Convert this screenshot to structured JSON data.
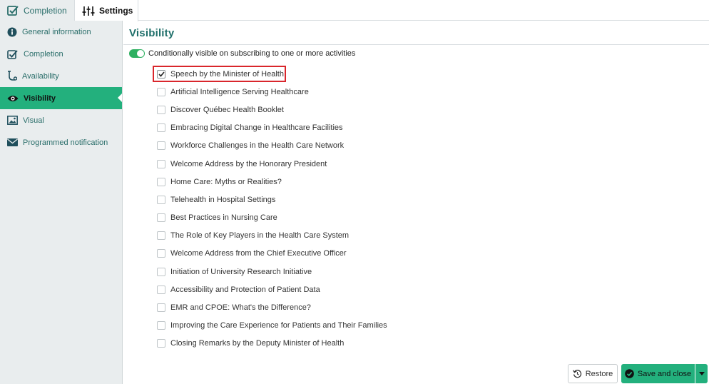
{
  "tabs": {
    "completion": "Completion",
    "settings": "Settings"
  },
  "sidebar": {
    "items": [
      {
        "label": "General information",
        "icon": "info-icon"
      },
      {
        "label": "Completion",
        "icon": "checkbox-check-icon"
      },
      {
        "label": "Availability",
        "icon": "availability-icon"
      },
      {
        "label": "Visibility",
        "icon": "eye-icon",
        "active": true
      },
      {
        "label": "Visual",
        "icon": "image-icon"
      },
      {
        "label": "Programmed notification",
        "icon": "envelope-icon"
      }
    ]
  },
  "main": {
    "title": "Visibility",
    "toggle_label": "Conditionally visible on subscribing to one or more activities",
    "toggle_on": true,
    "activities": [
      {
        "label": "Speech by the Minister of Health",
        "checked": true
      },
      {
        "label": "Artificial Intelligence Serving Healthcare",
        "checked": false
      },
      {
        "label": "Discover Québec Health Booklet",
        "checked": false
      },
      {
        "label": "Embracing Digital Change in Healthcare Facilities",
        "checked": false
      },
      {
        "label": "Workforce Challenges in the Health Care Network",
        "checked": false
      },
      {
        "label": "Welcome Address by the Honorary President",
        "checked": false
      },
      {
        "label": "Home Care: Myths or Realities?",
        "checked": false
      },
      {
        "label": "Telehealth in Hospital Settings",
        "checked": false
      },
      {
        "label": "Best Practices in Nursing Care",
        "checked": false
      },
      {
        "label": "The Role of Key Players in the Health Care System",
        "checked": false
      },
      {
        "label": "Welcome Address from the Chief Executive Officer",
        "checked": false
      },
      {
        "label": "Initiation of University Research Initiative",
        "checked": false
      },
      {
        "label": "Accessibility and Protection of Patient Data",
        "checked": false
      },
      {
        "label": "EMR and CPOE: What's the Difference?",
        "checked": false
      },
      {
        "label": "Improving the Care Experience for Patients and Their Families",
        "checked": false
      },
      {
        "label": "Closing Remarks by the Deputy Minister of Health",
        "checked": false
      }
    ]
  },
  "footer": {
    "restore_label": "Restore",
    "save_label": "Save and close"
  },
  "colors": {
    "accent": "#23b07d",
    "toggle": "#2eb061",
    "highlight": "#d9262c",
    "title": "#1f6f6a"
  }
}
